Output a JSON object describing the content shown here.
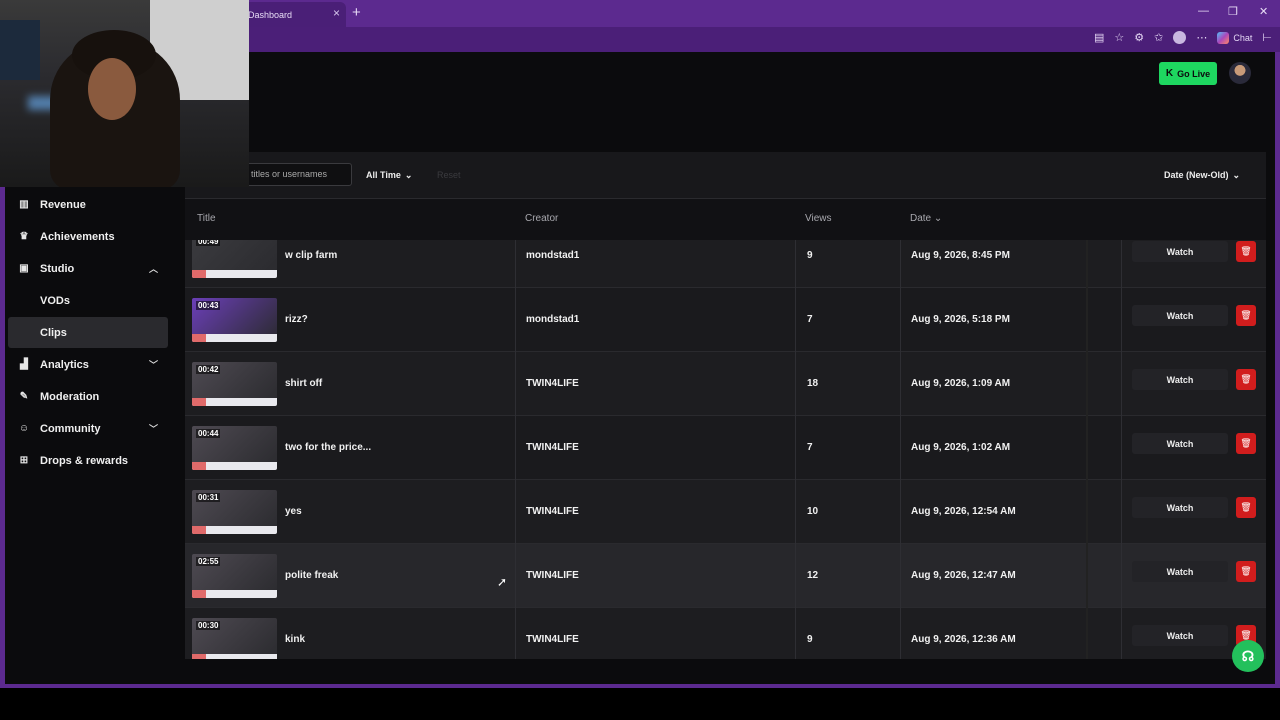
{
  "browser": {
    "tab_title": "Dashboard",
    "tab_close": "×",
    "new_tab": "+",
    "win_min": "—",
    "win_max": "❐",
    "win_close": "✕",
    "chat_label": "Chat"
  },
  "header": {
    "go_live_label": "Go Live"
  },
  "sidebar": {
    "items": [
      {
        "label": "Revenue",
        "icon": "bar-chart-icon"
      },
      {
        "label": "Achievements",
        "icon": "trophy-icon"
      },
      {
        "label": "Studio",
        "icon": "film-icon",
        "expanded": true
      },
      {
        "label": "VODs",
        "sub": true
      },
      {
        "label": "Clips",
        "sub": true,
        "active": true
      },
      {
        "label": "Analytics",
        "icon": "analytics-icon"
      },
      {
        "label": "Moderation",
        "icon": "wrench-icon"
      },
      {
        "label": "Community",
        "icon": "people-icon"
      },
      {
        "label": "Drops & rewards",
        "icon": "gift-icon"
      }
    ]
  },
  "filters": {
    "search_placeholder": "titles or usernames",
    "time_range": "All Time",
    "reset_label": "Reset",
    "sort": "Date (New-Old)"
  },
  "table": {
    "columns": {
      "title": "Title",
      "creator": "Creator",
      "views": "Views",
      "date": "Date"
    },
    "rows": [
      {
        "duration": "00:49",
        "title": "w clip farm",
        "creator": "mondstad1",
        "views": "9",
        "date": "Aug 9, 2026, 8:45 PM",
        "watch": "Watch",
        "thumb_color": "#3b3b3f"
      },
      {
        "duration": "00:43",
        "title": "rizz?",
        "creator": "mondstad1",
        "views": "7",
        "date": "Aug 9, 2026, 5:18 PM",
        "watch": "Watch",
        "thumb_color": "#6b3fb8"
      },
      {
        "duration": "00:42",
        "title": "shirt off",
        "creator": "TWIN4LIFE",
        "views": "18",
        "date": "Aug 9, 2026, 1:09 AM",
        "watch": "Watch",
        "thumb_color": "#4e4a52"
      },
      {
        "duration": "00:44",
        "title": "two for the price...",
        "creator": "TWIN4LIFE",
        "views": "7",
        "date": "Aug 9, 2026, 1:02 AM",
        "watch": "Watch",
        "thumb_color": "#4e4a52"
      },
      {
        "duration": "00:31",
        "title": "yes",
        "creator": "TWIN4LIFE",
        "views": "10",
        "date": "Aug 9, 2026, 12:54 AM",
        "watch": "Watch",
        "thumb_color": "#4e4a52"
      },
      {
        "duration": "02:55",
        "title": "polite freak",
        "creator": "TWIN4LIFE",
        "views": "12",
        "date": "Aug 9, 2026, 12:47 AM",
        "watch": "Watch",
        "thumb_color": "#4e4a52"
      },
      {
        "duration": "00:30",
        "title": "kink",
        "creator": "TWIN4LIFE",
        "views": "9",
        "date": "Aug 9, 2026, 12:36 AM",
        "watch": "Watch",
        "thumb_color": "#4e4a52"
      }
    ]
  },
  "colors": {
    "go_live": "#1ed760",
    "delete": "#d11d1d",
    "browser_frame": "#5c2a8f"
  }
}
